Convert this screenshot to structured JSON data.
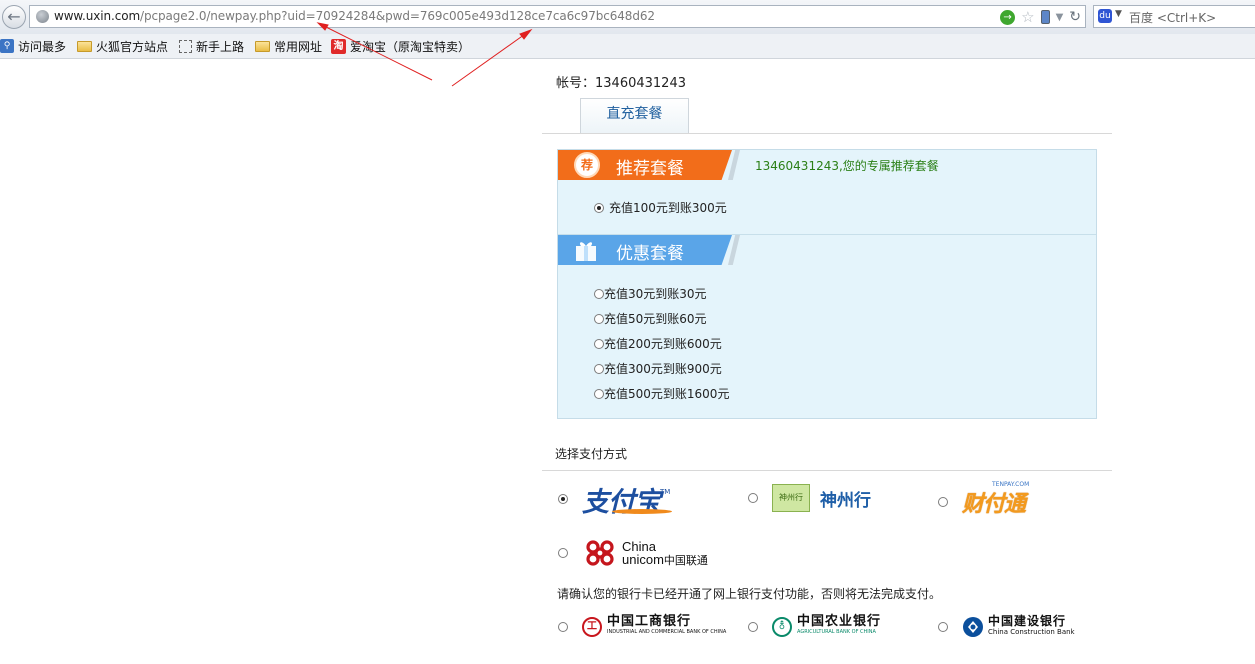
{
  "browser": {
    "url_domain": "www.uxin.com",
    "url_path": "/pcpage2.0/newpay.php?uid=70924284&pwd=769c005e493d128ce7ca6c97bc648d62",
    "search_placeholder": "百度 <Ctrl+K>",
    "search_badge": "du",
    "bookmarks": [
      {
        "label": "访问最多",
        "icon": "magnifier-icon"
      },
      {
        "label": "火狐官方站点",
        "icon": "folder-icon"
      },
      {
        "label": "新手上路",
        "icon": "dotted-box-icon"
      },
      {
        "label": "常用网址",
        "icon": "folder-icon"
      },
      {
        "label": "爱淘宝（原淘宝特卖）",
        "icon": "taobao-icon",
        "icon_text": "淘"
      }
    ],
    "annotation_arrow_color": "#e02020"
  },
  "account": {
    "label": "帐号：13460431243"
  },
  "tabs": [
    {
      "label": "直充套餐",
      "active": true
    }
  ],
  "recommended": {
    "title": "推荐套餐",
    "badge": "荐",
    "note": "13460431243,您的专属推荐套餐",
    "options": [
      {
        "label": "充值100元到账300元",
        "selected": true
      }
    ],
    "color": "#f26d1a"
  },
  "discount": {
    "title": "优惠套餐",
    "color": "#5aa5e8",
    "options": [
      {
        "label": "充值30元到账30元",
        "selected": false
      },
      {
        "label": "充值50元到账60元",
        "selected": false
      },
      {
        "label": "充值200元到账600元",
        "selected": false
      },
      {
        "label": "充值300元到账900元",
        "selected": false
      },
      {
        "label": "充值500元到账1600元",
        "selected": false
      }
    ]
  },
  "payment": {
    "title": "选择支付方式",
    "methods": [
      {
        "name": "alipay",
        "logo_text": "支付宝",
        "logo_tm": "TM",
        "selected": true
      },
      {
        "name": "shenzhouxing",
        "logo_text": "神州行",
        "badge_text": "神州行",
        "selected": false
      },
      {
        "name": "tenpay",
        "logo_text": "财付通",
        "logo_small": "TENPAY.COM",
        "selected": false
      },
      {
        "name": "unicom",
        "logo_en_1": "China",
        "logo_en_2": "unicom",
        "logo_cn": "中国联通",
        "selected": false
      }
    ],
    "bank_note": "请确认您的银行卡已经开通了网上银行支付功能，否则将无法完成支付。",
    "banks": [
      {
        "name": "icbc",
        "cn": "中国工商银行",
        "en": "INDUSTRIAL AND COMMERCIAL BANK OF CHINA",
        "color": "#c8161d",
        "selected": false
      },
      {
        "name": "abc",
        "cn": "中国农业银行",
        "en": "AGRICULTURAL BANK OF CHINA",
        "color": "#0a8a6a",
        "selected": false
      },
      {
        "name": "ccb",
        "cn": "中国建设银行",
        "en": "China Construction Bank",
        "color": "#0b4f9c",
        "selected": false
      }
    ]
  }
}
